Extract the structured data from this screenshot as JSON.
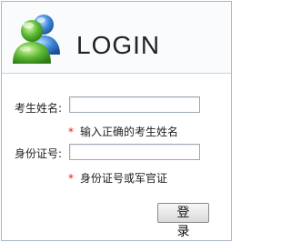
{
  "login_panel": {
    "title": "LOGIN",
    "logo_icon": "users-icon",
    "fields": [
      {
        "label": "考生姓名:",
        "value": "",
        "hint_marker": "*",
        "hint": "输入正确的考生姓名"
      },
      {
        "label": "身份证号:",
        "value": "",
        "hint_marker": "*",
        "hint": "身份证号或军官证"
      }
    ],
    "login_button": "登 录",
    "colors": {
      "accent_green": "#4aa72d",
      "accent_blue": "#3d73c9",
      "required_marker": "#e01c1c"
    }
  }
}
